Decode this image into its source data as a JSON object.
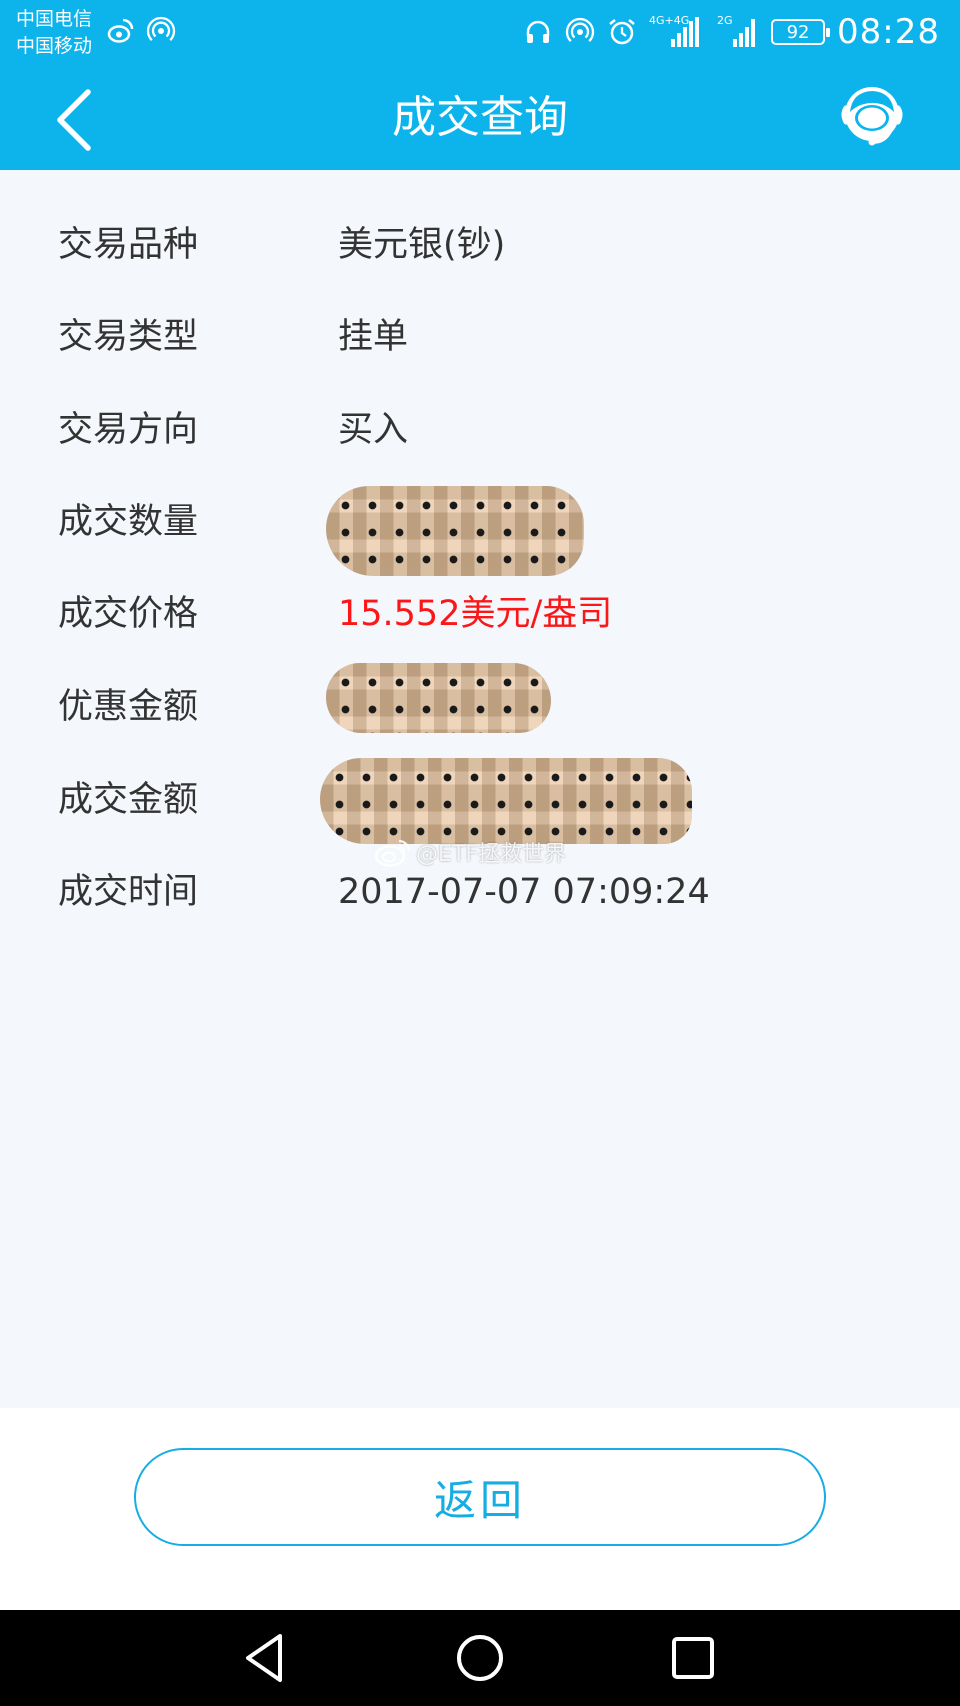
{
  "status_bar": {
    "carrier_1": "中国电信",
    "carrier_2": "中国移动",
    "network_tag_1": "4G+4G",
    "network_tag_2": "2G",
    "battery": "92",
    "time": "08:28"
  },
  "header": {
    "title": "成交查询",
    "back_icon": "chevron-left-icon",
    "service_icon": "customer-service-icon"
  },
  "details": [
    {
      "label": "交易品种",
      "value": "美元银(钞)"
    },
    {
      "label": "交易类型",
      "value": "挂单"
    },
    {
      "label": "交易方向",
      "value": "买入"
    },
    {
      "label": "成交数量",
      "value": ""
    },
    {
      "label": "成交价格",
      "value": "15.552美元/盎司"
    },
    {
      "label": "优惠金额",
      "value": ""
    },
    {
      "label": "成交金额",
      "value": ""
    },
    {
      "label": "成交时间",
      "value": "2017-07-07 07:09:24"
    }
  ],
  "watermark": "@ETF拯救世界",
  "footer": {
    "return_label": "返回"
  },
  "colors": {
    "primary": "#0db4ec",
    "accent": "#16ace4",
    "price": "#fb1717",
    "background": "#f4f7fb"
  }
}
